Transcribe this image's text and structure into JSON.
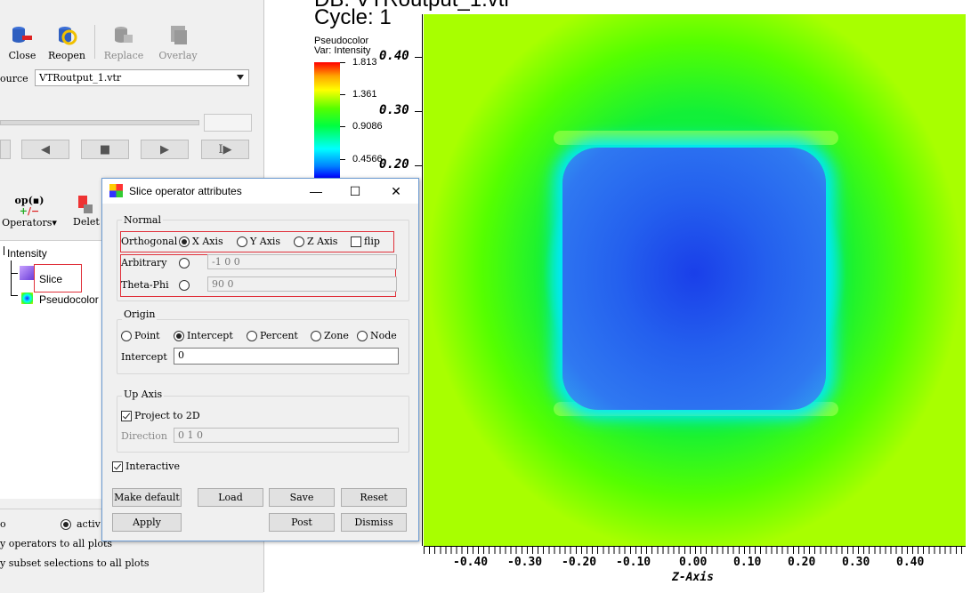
{
  "toolbar": {
    "close": "Close",
    "reopen": "Reopen",
    "replace": "Replace",
    "overlay": "Overlay"
  },
  "source": {
    "label": "ource",
    "value": "VTRoutput_1.vtr"
  },
  "operators": {
    "ops_label": "Operators",
    "ops_icon": "op(▪)",
    "delete_label": "Delet"
  },
  "plot_list": {
    "var": "Intensity",
    "operator": "Slice",
    "plot": "Pseudocolor"
  },
  "bottom": {
    "left_frag": "o",
    "active_frag": "activ",
    "line1": "y operators to all plots",
    "line2": "y subset selections to all plots"
  },
  "viewer": {
    "db_title": "DB: VTRoutput_1.vtr",
    "cycle": "Cycle: 1",
    "legend_title": "Pseudocolor",
    "legend_var": "Var: Intensity",
    "legend_labels": [
      "1.813",
      "1.361",
      "0.9086",
      "0.4566"
    ],
    "y_ticks": [
      "0.40",
      "0.30",
      "0.20"
    ],
    "x_ticks": [
      "-0.40",
      "-0.30",
      "-0.20",
      "-0.10",
      "0.00",
      "0.10",
      "0.20",
      "0.30",
      "0.40"
    ],
    "x_axis_title": "Z-Axis"
  },
  "dialog": {
    "title": "Slice operator attributes",
    "controls": {
      "minimize": "—",
      "maximize": "☐",
      "close": "✕"
    },
    "normal": {
      "group_title": "Normal",
      "orthogonal_label": "Orthogonal",
      "x_axis": "X Axis",
      "y_axis": "Y Axis",
      "z_axis": "Z Axis",
      "flip": "flip",
      "arbitrary_label": "Arbitrary",
      "arbitrary_value": "-1 0 0",
      "thetaphi_label": "Theta-Phi",
      "thetaphi_value": "90 0"
    },
    "origin": {
      "group_title": "Origin",
      "point": "Point",
      "intercept": "Intercept",
      "percent": "Percent",
      "zone": "Zone",
      "node": "Node",
      "intercept_label": "Intercept",
      "intercept_value": "0"
    },
    "upaxis": {
      "group_title": "Up Axis",
      "project": "Project to 2D",
      "direction_label": "Direction",
      "direction_value": "0 1 0"
    },
    "interactive": "Interactive",
    "buttons": {
      "make_default": "Make default",
      "load": "Load",
      "save": "Save",
      "reset": "Reset",
      "apply": "Apply",
      "post": "Post",
      "dismiss": "Dismiss"
    }
  }
}
